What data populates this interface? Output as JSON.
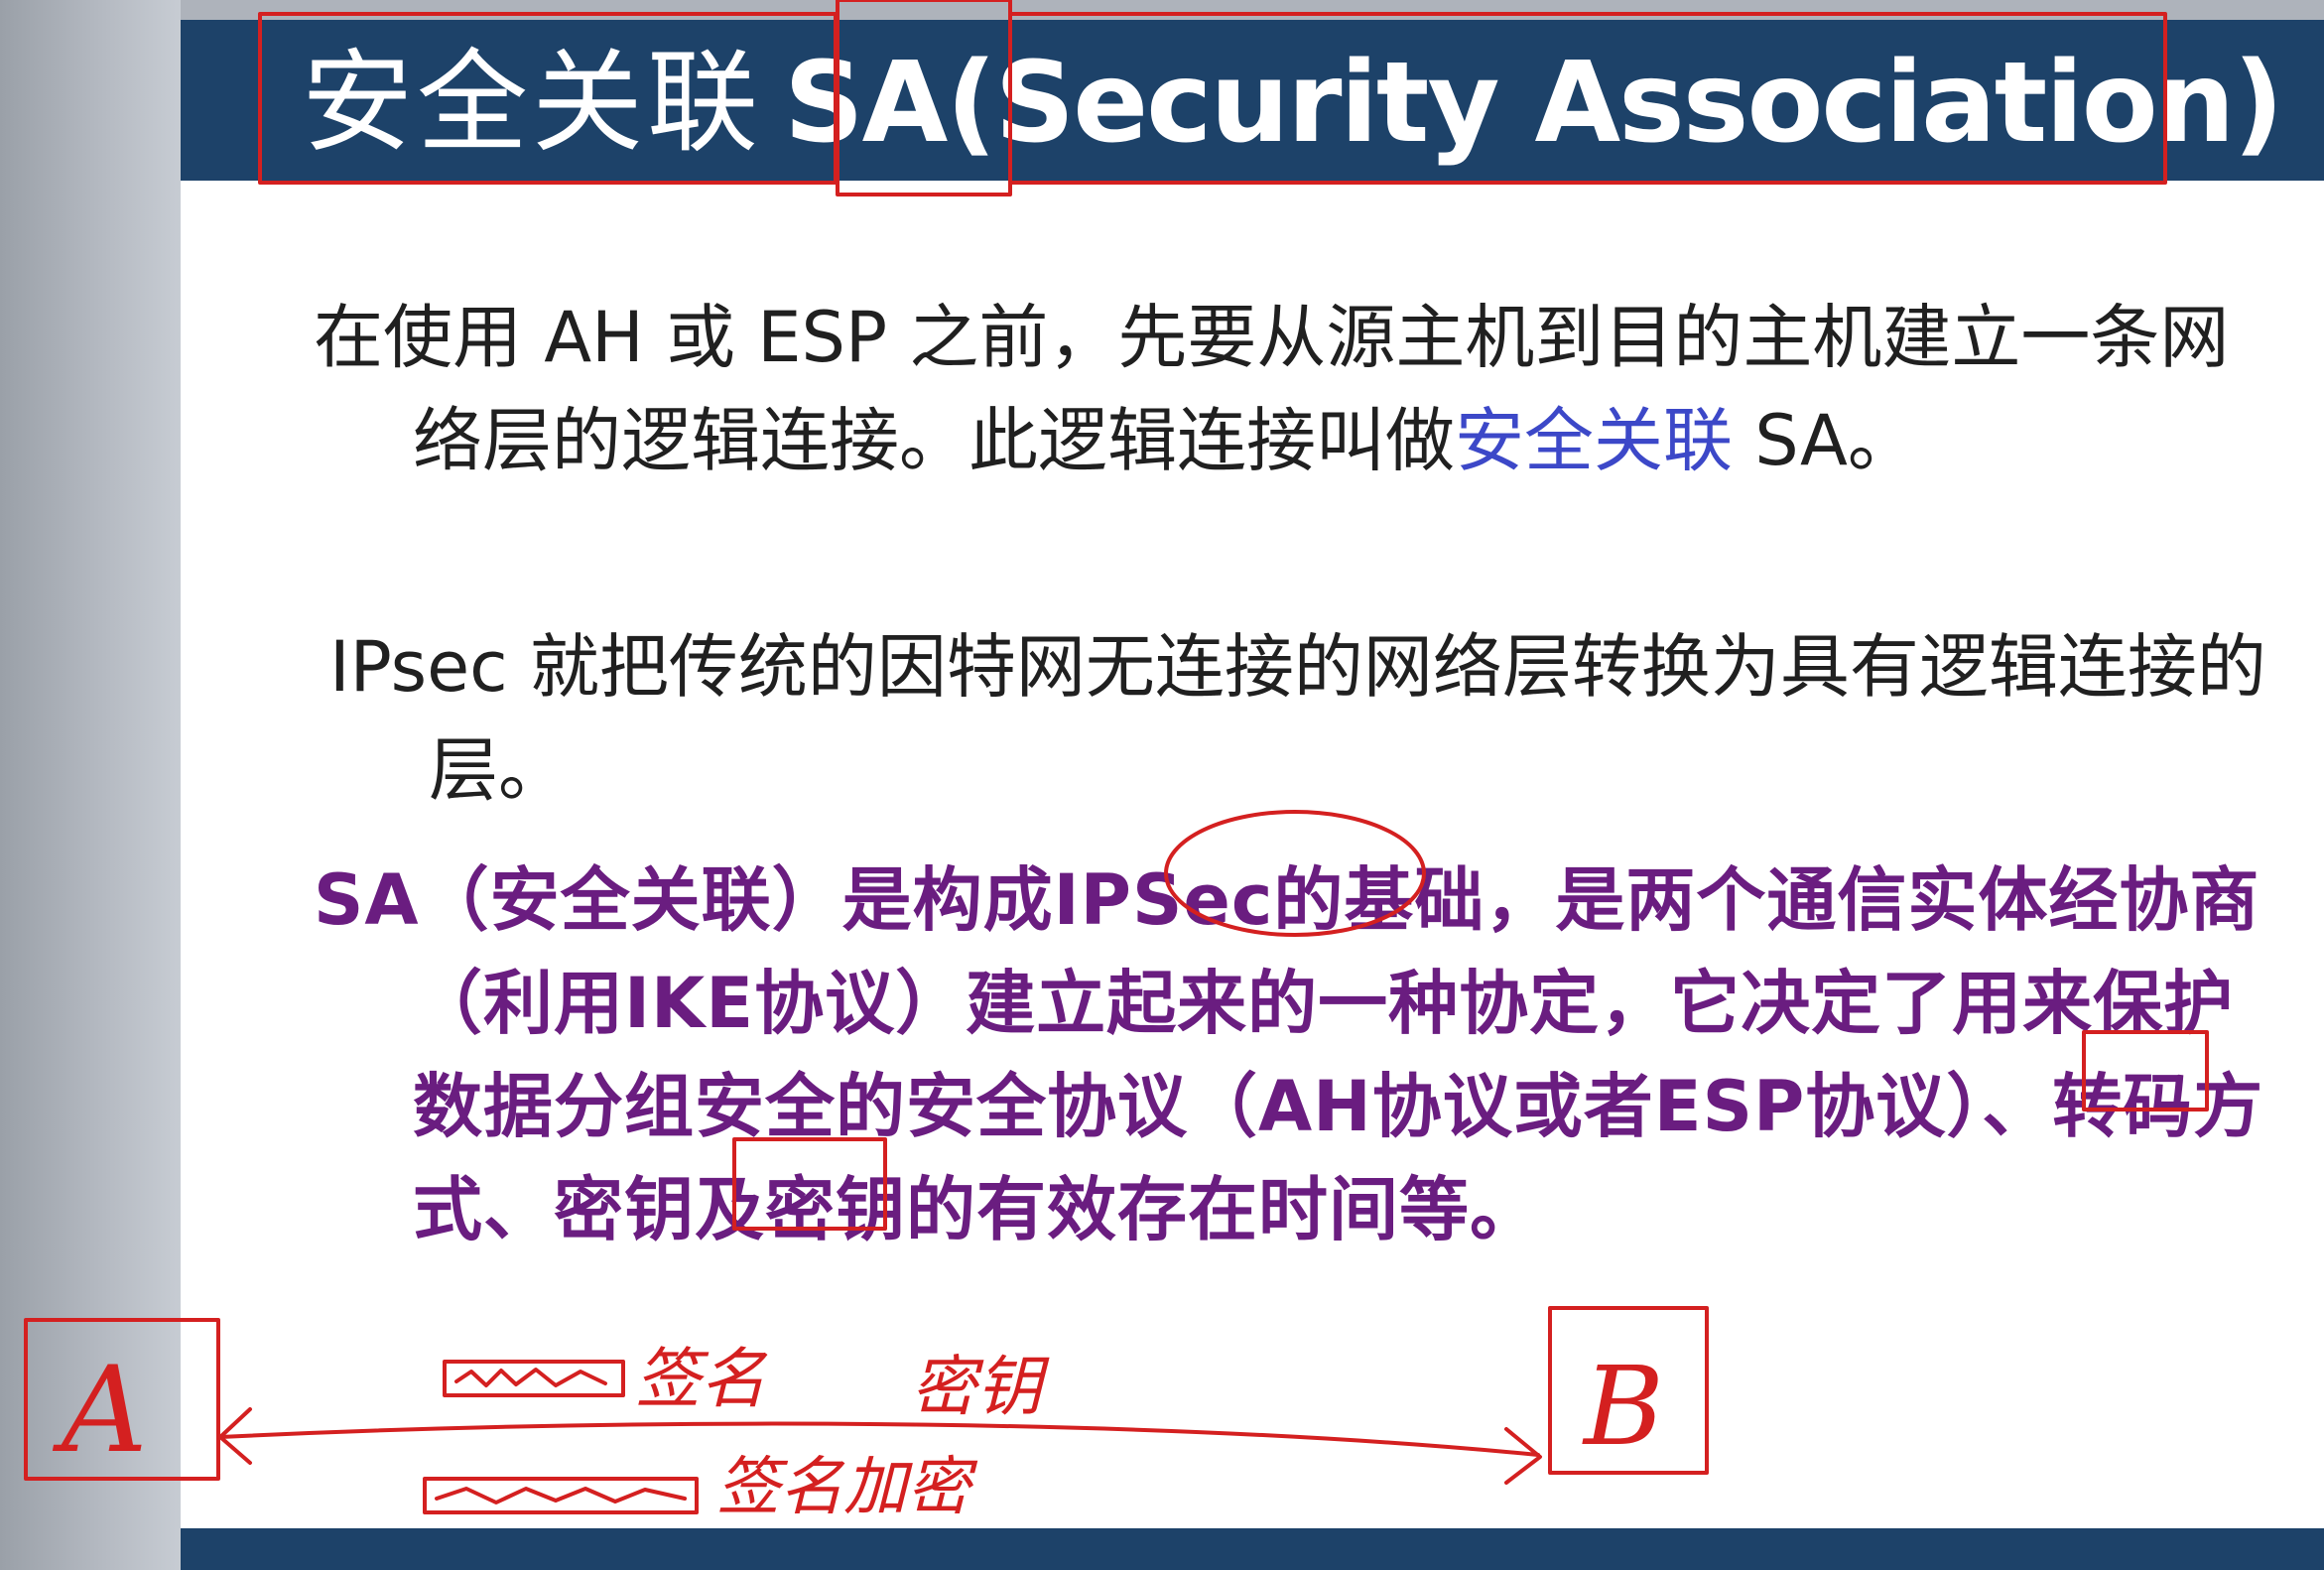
{
  "slide": {
    "title_zh": "安全关联",
    "title_sa": "SA",
    "title_en": "(Security Association)",
    "para1_a": "在使用 AH 或 ESP 之前，先要从源主机到目的主机建立一条网络层的逻辑连接。此逻辑连接叫做",
    "para1_link": "安全关联",
    "para1_b": " SA。",
    "para2": "IPsec 就把传统的因特网无连接的网络层转换为具有逻辑连接的层。",
    "para3": "SA（安全关联）是构成IPSec的基础，是两个通信实体经协商（利用IKE协议）建立起来的一种协定，它决定了用来保护数据分组安全的安全协议（AH协议或者ESP协议）、转码方式、密钥及密钥的有效存在时间等。"
  },
  "annotations": {
    "box_a_label": "A",
    "box_b_label": "B",
    "note1": "签名",
    "note2": "密钥",
    "note3": "签名加密",
    "ink_color": "#d42020"
  },
  "colors": {
    "title_bar": "#1d4269",
    "body_text": "#202020",
    "link_blue": "#3c48c8",
    "purple_text": "#6a1d80"
  }
}
